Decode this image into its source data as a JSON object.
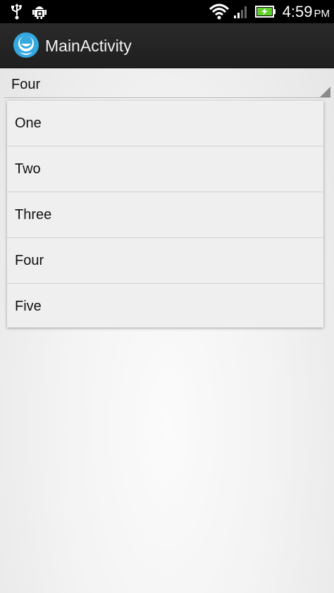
{
  "status_bar": {
    "time": "4:59",
    "ampm": "PM",
    "icons": [
      "usb-icon",
      "android-debug-icon",
      "wifi-icon",
      "signal-icon",
      "battery-charging-icon"
    ],
    "battery_color": "#5fcf2a"
  },
  "action_bar": {
    "title": "MainActivity",
    "icon": "app-icon",
    "accent": "#35a8e0"
  },
  "spinner": {
    "selected": "Four"
  },
  "dropdown": {
    "items": [
      "One",
      "Two",
      "Three",
      "Four",
      "Five"
    ]
  }
}
